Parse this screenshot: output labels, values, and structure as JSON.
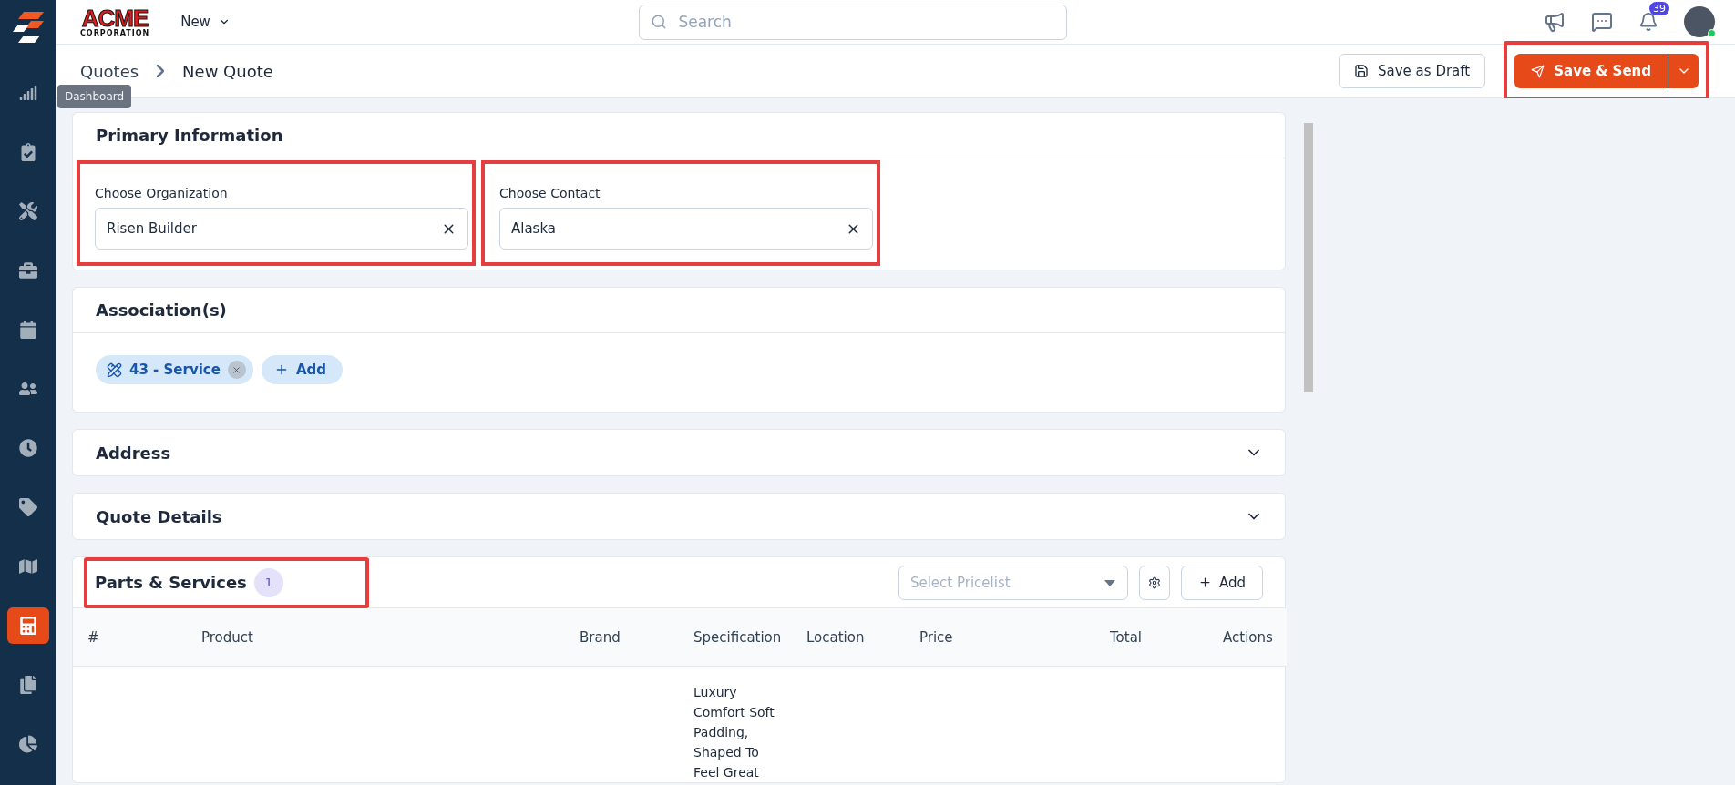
{
  "brand": {
    "logo_text": "ACME",
    "logo_subtext": "CORPORATION"
  },
  "topbar": {
    "new_menu": "New",
    "search": {
      "placeholder": "Search"
    },
    "notification_count": "39",
    "user_online": true
  },
  "sidebar": {
    "tooltip": "Dashboard",
    "items": [
      {
        "kind": "chart",
        "selected": false
      },
      {
        "kind": "clipboard",
        "selected": false
      },
      {
        "kind": "tools",
        "selected": false
      },
      {
        "kind": "briefcase",
        "selected": false
      },
      {
        "kind": "calendar",
        "selected": false
      },
      {
        "kind": "users",
        "selected": false
      },
      {
        "kind": "clock",
        "selected": false
      },
      {
        "kind": "tag",
        "selected": false
      },
      {
        "kind": "map",
        "selected": false
      },
      {
        "kind": "calculator",
        "selected": true
      },
      {
        "kind": "copy",
        "selected": false
      },
      {
        "kind": "pie",
        "selected": false
      }
    ]
  },
  "breadcrumb": [
    "Quotes",
    "New Quote"
  ],
  "actions": {
    "draft": "Save as Draft",
    "send": "Save & Send",
    "highlighted": true
  },
  "primary": {
    "title": "Primary Information",
    "fields": [
      {
        "label": "Choose Organization",
        "value": "Risen Builder",
        "highlighted": true
      },
      {
        "label": "Choose Contact",
        "value": "Alaska",
        "highlighted": true
      }
    ]
  },
  "associations": {
    "title": "Association(s)",
    "tags": [
      {
        "label": "43 - Service"
      }
    ],
    "add": "Add"
  },
  "collapsibles": [
    {
      "title": "Address",
      "expanded": false
    },
    {
      "title": "Quote Details",
      "expanded": false
    }
  ],
  "parts": {
    "title": "Parts & Services",
    "count": "1",
    "highlighted": true,
    "pricelist": {
      "placeholder": "Select Pricelist"
    },
    "add": "Add",
    "columns": [
      "#",
      "Product",
      "Brand",
      "Specification",
      "Location",
      "Price",
      "Total",
      "Actions"
    ],
    "rows": [
      {
        "specification": "Luxury Comfort Soft Padding, Shaped To Feel Great"
      }
    ]
  }
}
